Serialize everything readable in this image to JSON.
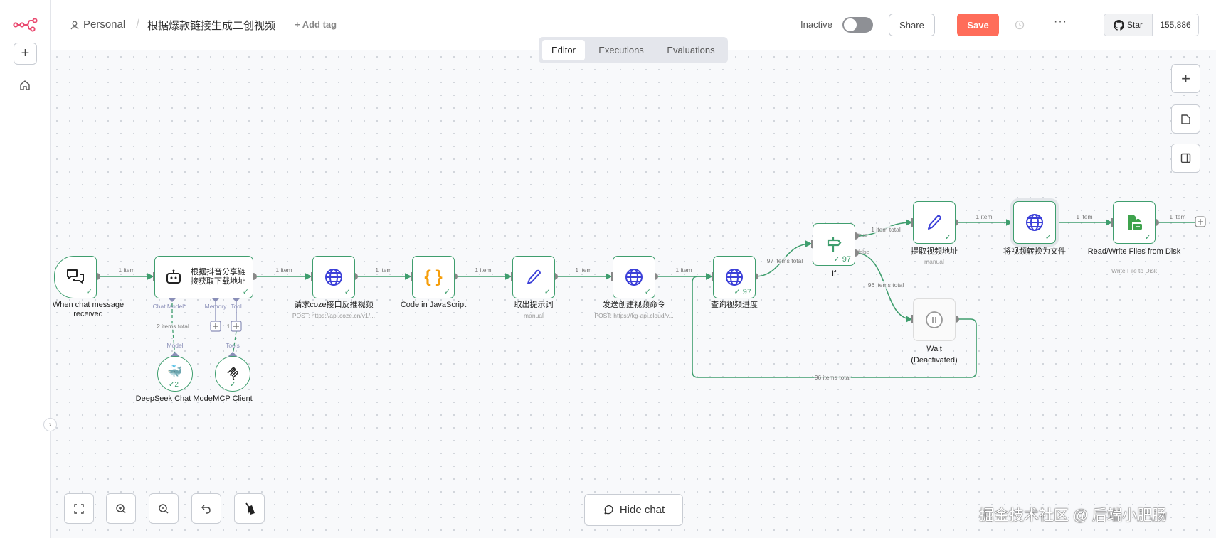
{
  "app": {
    "logo": "n8n-logo-icon"
  },
  "sidebar": {
    "add_button": "+",
    "home_icon": "home-icon",
    "collapse_icon": "chevron-right-icon"
  },
  "header": {
    "project": "Personal",
    "separator": "/",
    "workflow_title": "根据爆款链接生成二创视频",
    "add_tag": "+ Add tag",
    "status_label": "Inactive",
    "active": false,
    "share": "Share",
    "save": "Save",
    "github_star": "Star",
    "github_count": "155,886"
  },
  "tabs": [
    {
      "label": "Editor",
      "active": true
    },
    {
      "label": "Executions",
      "active": false
    },
    {
      "label": "Evaluations",
      "active": false
    }
  ],
  "colors": {
    "accent": "#ff6d5a",
    "success": "#3f9e6e",
    "http": "#3b3fd8",
    "code": "#f59e0b"
  },
  "nodes": {
    "trigger": {
      "name": "When chat message received",
      "shown": "hen chat message received",
      "icon": "chat-icon"
    },
    "agent": {
      "name": "根据抖音分享链接获取下载地址",
      "icon": "robot-icon",
      "handles": [
        "Chat Model*",
        "Memory",
        "Tool"
      ]
    },
    "coze": {
      "name": "请求coze接口反推视频",
      "sub": "POST: https://api.coze.cn/v1/...",
      "icon": "globe-icon"
    },
    "code": {
      "name": "Code in JavaScript",
      "icon": "code-braces-icon"
    },
    "extract_prompt": {
      "name": "取出提示词",
      "sub": "manual",
      "icon": "pen-icon"
    },
    "send": {
      "name": "发送创建视频命令",
      "sub": "POST: https://kg-api.cloud/v...",
      "icon": "globe-icon"
    },
    "query": {
      "name": "查询视频进度",
      "count": "97",
      "icon": "globe-icon"
    },
    "if": {
      "name": "If",
      "count": "97",
      "true": "true",
      "false": "false",
      "icon": "signpost-icon"
    },
    "extract_url": {
      "name": "提取视频地址",
      "sub": "manual",
      "icon": "pen-icon"
    },
    "convert": {
      "name": "将视频转换为文件",
      "icon": "globe-icon"
    },
    "rw": {
      "name": "Read/Write Files from Disk",
      "sub": "Write File to Disk",
      "icon": "file-disk-icon"
    },
    "wait": {
      "name": "Wait",
      "state": "(Deactivated)",
      "icon": "pause-icon"
    },
    "deepseek": {
      "name": "DeepSeek Chat Model",
      "count": "2",
      "handle": "Model",
      "icon": "deepseek-whale-icon"
    },
    "mcp": {
      "name": "MCP Client",
      "handle": "Tools",
      "icon": "mcp-icon"
    }
  },
  "edges": {
    "one_item": "1 item",
    "e97": "97 items total",
    "true_total": "1 item total",
    "false_total": "96 items total",
    "loop_total": "96 items total",
    "model_total": "2 items total",
    "tool_count": "1"
  },
  "controls": {
    "hide_chat": "Hide chat"
  },
  "watermark": "掘金技术社区 @ 后端小肥肠"
}
